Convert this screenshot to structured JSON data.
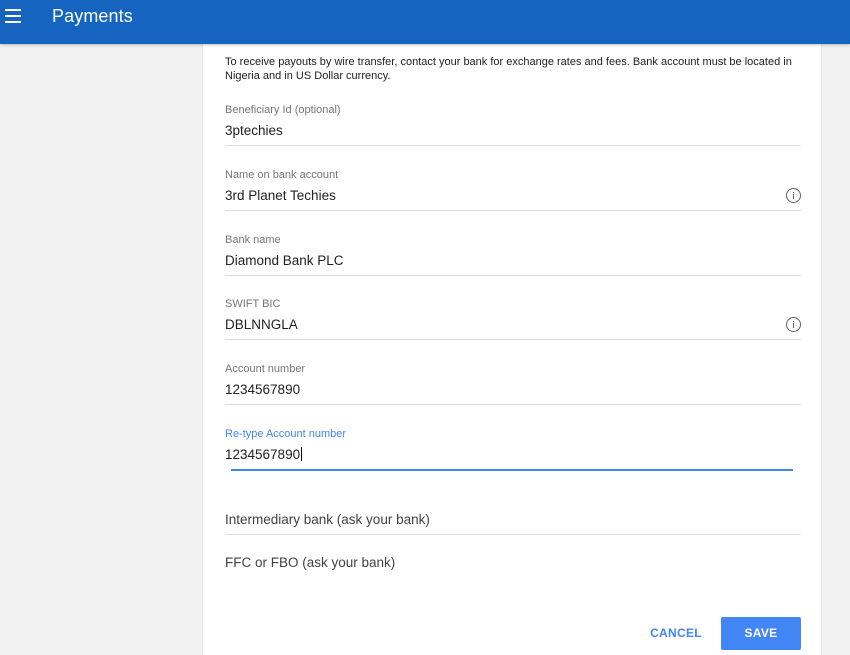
{
  "appbar": {
    "title": "Payments",
    "menu_icon": "menu-icon",
    "color": "#1565c0"
  },
  "form": {
    "intro": "To receive payouts by wire transfer, contact your bank for exchange rates and fees. Bank account must be located in Nigeria and in US Dollar currency.",
    "fields": {
      "beneficiary_id": {
        "label": "Beneficiary Id (optional)",
        "value": "3ptechies"
      },
      "name_on_account": {
        "label": "Name on bank account",
        "value": "3rd Planet Techies",
        "icon": "info-icon"
      },
      "bank_name": {
        "label": "Bank name",
        "value": "Diamond Bank PLC"
      },
      "swift_bic": {
        "label": "SWIFT BIC",
        "value": "DBLNNGLA",
        "icon": "info-icon"
      },
      "account_number": {
        "label": "Account number",
        "value": "1234567890"
      },
      "retype_account_number": {
        "label": "Re-type Account number",
        "value": "1234567890",
        "focused": true
      }
    },
    "intermediary_bank": {
      "placeholder": "Intermediary bank (ask your bank)"
    },
    "ffc_fbo": {
      "placeholder": "FFC or FBO (ask your bank)"
    },
    "actions": {
      "cancel_label": "CANCEL",
      "save_label": "SAVE"
    },
    "accent_color": "#4285f4"
  }
}
